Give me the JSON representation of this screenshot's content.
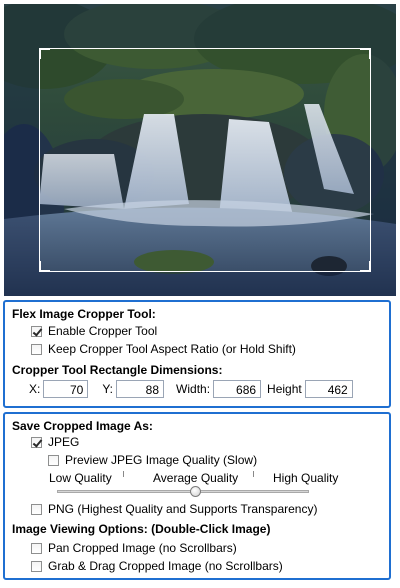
{
  "image": {
    "subject": "waterfall-photo",
    "crop_overlay_color": "#ffffff"
  },
  "cropper": {
    "title": "Flex Image Cropper Tool:",
    "enable_label": "Enable Cropper Tool",
    "enable_checked": true,
    "aspect_label": "Keep Cropper Tool Aspect Ratio (or Hold Shift)",
    "aspect_checked": false
  },
  "dimensions": {
    "title": "Cropper Tool Rectangle Dimensions:",
    "x_label": "X:",
    "x_value": "70",
    "y_label": "Y:",
    "y_value": "88",
    "width_label": "Width:",
    "width_value": "686",
    "height_label": "Height",
    "height_value": "462"
  },
  "save": {
    "title": "Save Cropped Image As:",
    "jpeg_label": "JPEG",
    "jpeg_checked": true,
    "preview_label": "Preview JPEG Image Quality (Slow)",
    "preview_checked": false,
    "quality_low": "Low Quality",
    "quality_avg": "Average Quality",
    "quality_high": "High Quality",
    "quality_level": 0.55,
    "png_label": "PNG (Highest Quality and Supports Transparency)",
    "png_checked": false
  },
  "viewing": {
    "title": "Image Viewing Options: (Double-Click Image)",
    "pan_label": "Pan Cropped Image (no Scrollbars)",
    "pan_checked": false,
    "grab_label": "Grab & Drag Cropped Image (no Scrollbars)",
    "grab_checked": false
  },
  "colors": {
    "panel_border": "#1f6fd1"
  }
}
